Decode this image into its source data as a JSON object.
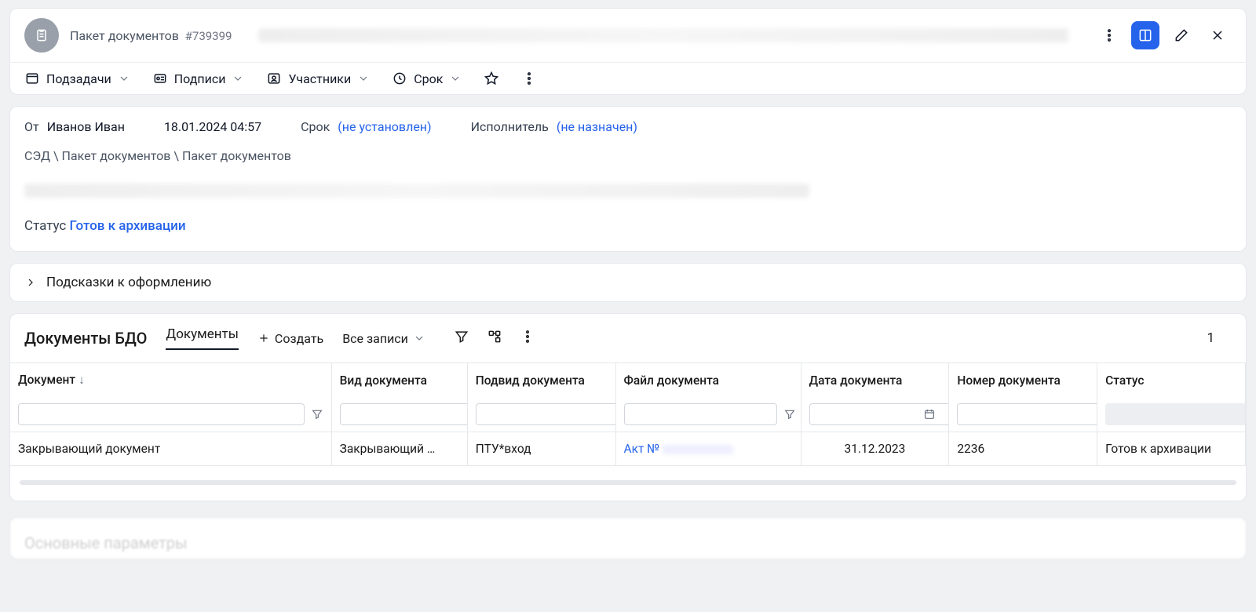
{
  "header": {
    "type_label": "Пакет документов",
    "id": "#739399"
  },
  "toolbar": {
    "subtasks": "Подзадачи",
    "signatures": "Подписи",
    "participants": "Участники",
    "deadline": "Срок"
  },
  "info": {
    "from_label": "От",
    "from_value": "Иванов Иван",
    "datetime": "18.01.2024 04:57",
    "deadline_label": "Срок",
    "deadline_value": "(не установлен)",
    "executor_label": "Исполнитель",
    "executor_value": "(не назначен)",
    "breadcrumb": "СЭД \\ Пакет документов \\ Пакет документов",
    "status_label": "Статус",
    "status_value": "Готов к архивации"
  },
  "hints": {
    "title": "Подсказки к оформлению"
  },
  "docs": {
    "section_title": "Документы БДО",
    "tab_label": "Документы",
    "create_label": "Создать",
    "all_records_label": "Все записи",
    "count": "1",
    "columns": {
      "doc": "Документ",
      "kind": "Вид документа",
      "subkind": "Подвид документа",
      "file": "Файл документа",
      "date": "Дата документа",
      "number": "Номер документа",
      "status": "Статус"
    },
    "row": {
      "doc": "Закрывающий документ",
      "kind": "Закрывающий …",
      "subkind": "ПТУ*вход",
      "file": "Акт №",
      "date": "31.12.2023",
      "number": "2236",
      "status": "Готов к архивации"
    }
  },
  "bottom_section": {
    "title": "Основные параметры"
  }
}
